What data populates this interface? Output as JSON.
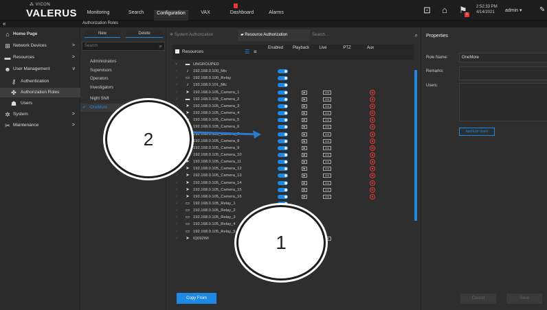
{
  "brand": {
    "small": "⁂ VICON",
    "big": "VALERUS"
  },
  "topnav": [
    {
      "label": "Monitoring",
      "active": false
    },
    {
      "label": "Search",
      "active": false
    },
    {
      "label": "Configuration",
      "active": true
    },
    {
      "label": "VAX",
      "active": false
    },
    {
      "label": "Dashboard",
      "active": false
    },
    {
      "label": "Alarms",
      "active": false
    }
  ],
  "status": {
    "badge": "1",
    "time": "2:52:33 PM",
    "date": "4/14/2021",
    "user": "admin ▾"
  },
  "breadcrumb": {
    "collapse": "«",
    "title": "Authorization Roles"
  },
  "leftnav": [
    {
      "label": "Home Page",
      "icon": "home-icon",
      "glyph": "⌂",
      "chev": "",
      "sub": false,
      "sel": false,
      "bold": true
    },
    {
      "label": "Network Devices",
      "icon": "network-icon",
      "glyph": "⊞",
      "chev": ">",
      "sub": false,
      "sel": false
    },
    {
      "label": "Resources",
      "icon": "resources-icon",
      "glyph": "▬",
      "chev": ">",
      "sub": false,
      "sel": false
    },
    {
      "label": "User Management",
      "icon": "users-icon",
      "glyph": "☻",
      "chev": "v",
      "sub": false,
      "sel": false
    },
    {
      "label": "Authentication",
      "icon": "key-icon",
      "glyph": "⚷",
      "chev": "",
      "sub": true,
      "sel": false
    },
    {
      "label": "Authorization Roles",
      "icon": "roles-icon",
      "glyph": "✤",
      "chev": "",
      "sub": true,
      "sel": true
    },
    {
      "label": "Users",
      "icon": "user-icon",
      "glyph": "☗",
      "chev": "",
      "sub": true,
      "sel": false
    },
    {
      "label": "System",
      "icon": "gear-icon",
      "glyph": "✲",
      "chev": ">",
      "sub": false,
      "sel": false
    },
    {
      "label": "Maintenance",
      "icon": "tools-icon",
      "glyph": "✂",
      "chev": ">",
      "sub": false,
      "sel": false
    }
  ],
  "roles": {
    "new_label": "New",
    "delete_label": "Delete",
    "search_placeholder": "Search",
    "items": [
      {
        "label": "Administrators",
        "sel": false
      },
      {
        "label": "Supervisors",
        "sel": false
      },
      {
        "label": "Operators",
        "sel": false
      },
      {
        "label": "Investigators",
        "sel": false
      },
      {
        "label": "Night Shift",
        "sel": false
      },
      {
        "label": "OneMore",
        "sel": true
      }
    ]
  },
  "resources": {
    "tab_system": "System Authorization",
    "tab_resource": "Resource Authorization",
    "search_placeholder": "Search...",
    "header": "Resources",
    "columns": [
      "Enabled",
      "Playback",
      "Live",
      "PTZ",
      "Aux"
    ],
    "copy_from": "Copy From",
    "rows": [
      {
        "name": "UNGROUPED",
        "icon": "folder-icon",
        "glyph": "▬",
        "enabled": false,
        "playback": false,
        "live": false,
        "aux": false,
        "group": true
      },
      {
        "name": "192.168.0.100_Mic",
        "icon": "mic-icon",
        "glyph": "♪",
        "enabled": true,
        "playback": false,
        "live": false,
        "aux": false
      },
      {
        "name": "192.168.0.100_Relay",
        "icon": "relay-icon",
        "glyph": "▭",
        "enabled": true,
        "playback": false,
        "live": false,
        "aux": false
      },
      {
        "name": "192.168.0.101_Mic",
        "icon": "mic-icon",
        "glyph": "♪",
        "enabled": true,
        "playback": false,
        "live": false,
        "aux": false
      },
      {
        "name": "192.168.0.105_Camera_1",
        "icon": "camera-icon",
        "glyph": "➤",
        "enabled": true,
        "playback": true,
        "live": true,
        "aux": true
      },
      {
        "name": "192.168.0.105_Camera_2",
        "icon": "camera-icon",
        "glyph": "▬",
        "enabled": true,
        "playback": true,
        "live": true,
        "aux": true
      },
      {
        "name": "192.168.0.105_Camera_3",
        "icon": "camera-icon",
        "glyph": "➤",
        "enabled": true,
        "playback": true,
        "live": true,
        "aux": true
      },
      {
        "name": "192.168.0.105_Camera_4",
        "icon": "camera-icon",
        "glyph": "➤",
        "enabled": true,
        "playback": true,
        "live": true,
        "aux": true
      },
      {
        "name": "192.168.0.105_Camera_5",
        "icon": "camera-icon",
        "glyph": "➤",
        "enabled": true,
        "playback": true,
        "live": true,
        "aux": true
      },
      {
        "name": "192.168.0.105_Camera_6",
        "icon": "camera-icon",
        "glyph": "➤",
        "enabled": true,
        "playback": true,
        "live": true,
        "aux": true
      },
      {
        "name": "192.168.0.105_Camera_7",
        "icon": "camera-icon",
        "glyph": "➤",
        "enabled": true,
        "playback": true,
        "live": true,
        "aux": true
      },
      {
        "name": "192.168.0.105_Camera_8",
        "icon": "camera-icon",
        "glyph": "➤",
        "enabled": true,
        "playback": true,
        "live": true,
        "aux": true
      },
      {
        "name": "192.168.0.105_Camera_9",
        "icon": "camera-icon",
        "glyph": "➤",
        "enabled": true,
        "playback": true,
        "live": true,
        "aux": true
      },
      {
        "name": "192.168.0.105_Camera_10",
        "icon": "camera-icon",
        "glyph": "➤",
        "enabled": true,
        "playback": true,
        "live": true,
        "aux": true
      },
      {
        "name": "192.168.0.105_Camera_11",
        "icon": "camera-icon",
        "glyph": "➤",
        "enabled": true,
        "playback": true,
        "live": true,
        "aux": true
      },
      {
        "name": "192.168.0.105_Camera_12",
        "icon": "camera-icon",
        "glyph": "➤",
        "enabled": true,
        "playback": true,
        "live": true,
        "aux": true
      },
      {
        "name": "192.168.0.105_Camera_13",
        "icon": "camera-icon",
        "glyph": "➤",
        "enabled": true,
        "playback": true,
        "live": true,
        "aux": true
      },
      {
        "name": "192.168.0.105_Camera_14",
        "icon": "camera-icon",
        "glyph": "➤",
        "enabled": true,
        "playback": true,
        "live": true,
        "aux": true
      },
      {
        "name": "192.168.0.105_Camera_15",
        "icon": "camera-icon",
        "glyph": "➤",
        "enabled": true,
        "playback": true,
        "live": true,
        "aux": true
      },
      {
        "name": "192.168.0.105_Camera_16",
        "icon": "camera-icon",
        "glyph": "➤",
        "enabled": true,
        "playback": true,
        "live": true,
        "aux": true
      },
      {
        "name": "192.168.0.105_Relay_1",
        "icon": "relay-icon",
        "glyph": "▭",
        "enabled": true,
        "playback": false,
        "live": false,
        "aux": false
      },
      {
        "name": "192.168.0.105_Relay_2",
        "icon": "relay-icon",
        "glyph": "▭",
        "enabled": true,
        "playback": false,
        "live": false,
        "aux": false
      },
      {
        "name": "192.168.0.105_Relay_3",
        "icon": "relay-icon",
        "glyph": "▭",
        "enabled": true,
        "playback": false,
        "live": false,
        "aux": false
      },
      {
        "name": "192.168.0.105_Relay_4",
        "icon": "relay-icon",
        "glyph": "▭",
        "enabled": true,
        "playback": false,
        "live": false,
        "aux": false
      },
      {
        "name": "192.168.0.105_Relay_5",
        "icon": "relay-icon",
        "glyph": "▭",
        "enabled": true,
        "playback": false,
        "live": false,
        "aux": false
      },
      {
        "name": "IQ092WI",
        "icon": "camera-icon",
        "glyph": "➤",
        "enabled": false,
        "playback": false,
        "live": true,
        "aux": false
      }
    ]
  },
  "properties": {
    "title": "Properties",
    "role_name_label": "Role Name:",
    "role_name_value": "OneMore",
    "remarks_label": "Remarks:",
    "users_label": "Users:",
    "add_edit_users": "Add/Edit Users",
    "cancel": "Cancel",
    "save": "Save"
  },
  "callouts": [
    {
      "number": "1"
    },
    {
      "number": "2"
    }
  ]
}
